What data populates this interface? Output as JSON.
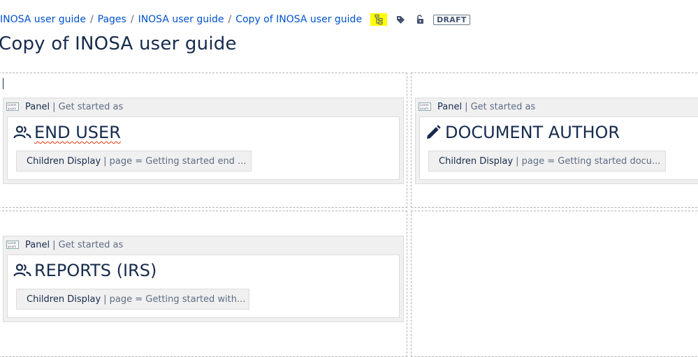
{
  "breadcrumb": [
    {
      "label": "INOSA user guide"
    },
    {
      "label": "Pages"
    },
    {
      "label": "INOSA user guide"
    },
    {
      "label": "Copy of INOSA user guide"
    }
  ],
  "breadcrumb_separator": "/",
  "status_badge": "DRAFT",
  "page_title": "Copy of INOSA user guide",
  "panels": [
    {
      "macro_name": "Panel",
      "macro_params": "| Get started as",
      "heading": "END USER",
      "icon": "users-icon",
      "child_macro_name": "Children Display",
      "child_macro_params": "| page = Getting started end ..."
    },
    {
      "macro_name": "Panel",
      "macro_params": "| Get started as",
      "heading": "DOCUMENT AUTHOR",
      "icon": "pencil-icon",
      "child_macro_name": "Children Display",
      "child_macro_params": "| page = Getting started docu..."
    },
    {
      "macro_name": "Panel",
      "macro_params": "| Get started as",
      "heading": "REPORTS (IRS)",
      "icon": "users-icon",
      "child_macro_name": "Children Display",
      "child_macro_params": "| page = Getting started with..."
    }
  ],
  "colors": {
    "link": "#0052cc",
    "highlight": "#ffff00",
    "macro_bg": "#f0f0f0",
    "spellcheck": "#de350b"
  }
}
